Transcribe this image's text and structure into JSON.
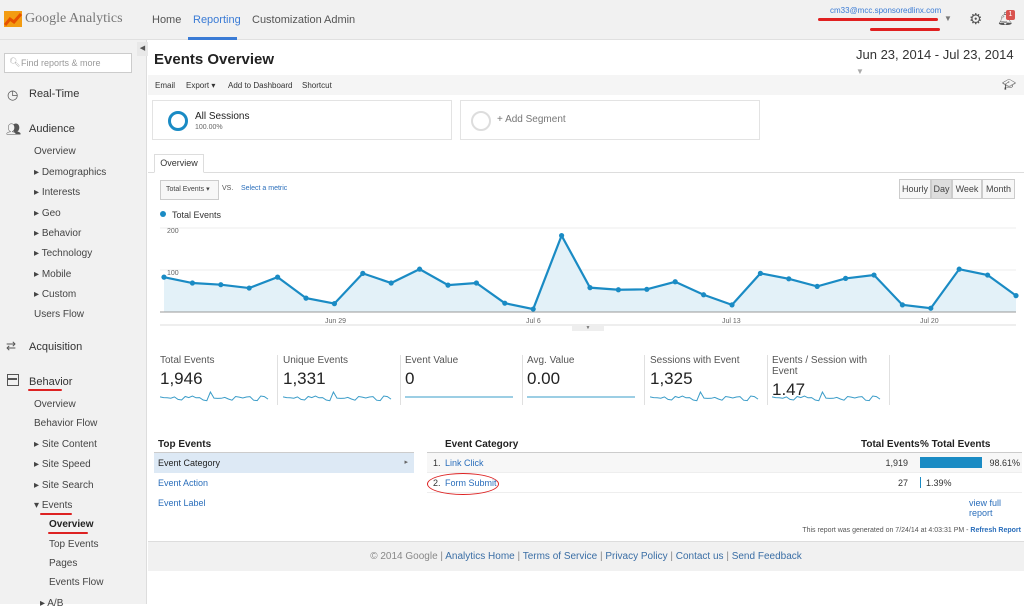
{
  "app": {
    "logo": "Google Analytics",
    "nav": [
      "Home",
      "Reporting",
      "Customization",
      "Admin"
    ],
    "active_nav": "Reporting",
    "account_email": "cm33@mcc.sponsoredlinx.com",
    "notification_count": "1",
    "accent": "#3a7bd5"
  },
  "sidebar": {
    "search_placeholder": "Find reports & more",
    "sections": [
      {
        "label": "Real-Time",
        "icon": "clock-icon"
      },
      {
        "label": "Audience",
        "icon": "people-icon",
        "items": [
          "Overview",
          "Demographics",
          "Interests",
          "Geo",
          "Behavior",
          "Technology",
          "Mobile",
          "Custom",
          "Users Flow"
        ]
      },
      {
        "label": "Acquisition",
        "icon": "arrows-icon"
      },
      {
        "label": "Behavior",
        "icon": "layout-icon",
        "items": [
          "Overview",
          "Behavior Flow",
          "Site Content",
          "Site Speed",
          "Site Search",
          "Events"
        ],
        "events_items": [
          "Overview",
          "Top Events",
          "Pages",
          "Events Flow"
        ],
        "more": "A/B"
      }
    ]
  },
  "page": {
    "title": "Events Overview",
    "date_range": "Jun 23, 2014 - Jul 23, 2014",
    "toolbar": [
      "Email",
      "Export",
      "Add to Dashboard",
      "Shortcut"
    ],
    "segment": {
      "name": "All Sessions",
      "pct": "100.00%",
      "add": "+ Add Segment"
    },
    "tab": "Overview",
    "metric_select": "Total Events",
    "vs": "VS.",
    "select_metric": "Select a metric",
    "granularity": [
      "Hourly",
      "Day",
      "Week",
      "Month"
    ],
    "active_granularity": "Day"
  },
  "chart_data": {
    "type": "area",
    "series": [
      {
        "name": "Total Events",
        "color": "#1a8bc4",
        "values": [
          83,
          69,
          65,
          57,
          83,
          33,
          20,
          92,
          69,
          102,
          64,
          69,
          21,
          7,
          182,
          58,
          53,
          54,
          72,
          41,
          17,
          92,
          79,
          61,
          80,
          88,
          17,
          9,
          102,
          88,
          39
        ]
      }
    ],
    "x_start": "Jun 23",
    "x_ticks": [
      "Jun 29",
      "Jul 6",
      "Jul 13",
      "Jul 20"
    ],
    "y_ticks": [
      "100",
      "200"
    ],
    "ylim": [
      0,
      200
    ],
    "legend": "top-left",
    "grid": true
  },
  "scorecards": [
    {
      "label": "Total Events",
      "value": "1,946"
    },
    {
      "label": "Unique Events",
      "value": "1,331"
    },
    {
      "label": "Event Value",
      "value": "0"
    },
    {
      "label": "Avg. Value",
      "value": "0.00"
    },
    {
      "label": "Sessions with Event",
      "value": "1,325"
    },
    {
      "label": "Events / Session with Event",
      "value": "1.47"
    }
  ],
  "top_events": {
    "title": "Top Events",
    "items": [
      "Event Category",
      "Event Action",
      "Event Label"
    ],
    "active": "Event Category"
  },
  "table": {
    "headers": [
      "Event Category",
      "Total Events",
      "% Total Events"
    ],
    "rows": [
      {
        "rank": "1.",
        "name": "Link Click",
        "total": "1,919",
        "pct": "98.61%",
        "frac": 0.9861
      },
      {
        "rank": "2.",
        "name": "Form Submit",
        "total": "27",
        "pct": "1.39%",
        "frac": 0.0139
      }
    ],
    "view_full": "view full report"
  },
  "generated": {
    "text": "This report was generated on 7/24/14 at 4:03:31 PM - ",
    "refresh": "Refresh Report"
  },
  "footer": {
    "copy": "© 2014 Google",
    "links": [
      "Analytics Home",
      "Terms of Service",
      "Privacy Policy",
      "Contact us",
      "Send Feedback"
    ]
  }
}
